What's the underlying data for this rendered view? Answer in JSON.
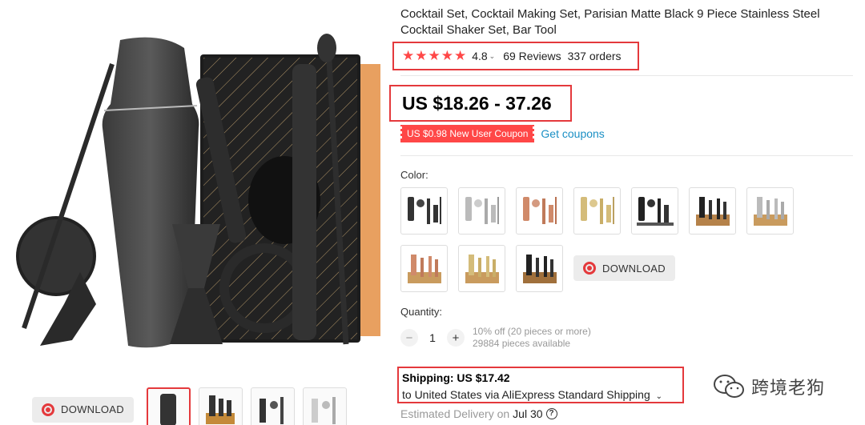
{
  "product": {
    "title": "Cocktail Set, Cocktail Making Set, Parisian Matte Black 9 Piece Stainless Steel Cocktail Shaker Set, Bar Tool",
    "stars": "★★★★★",
    "rating": "4.8",
    "reviews": "69 Reviews",
    "orders": "337 orders",
    "price": "US $18.26 - 37.26",
    "coupon": "US $0.98 New User Coupon",
    "get_coupons": "Get coupons"
  },
  "color": {
    "label": "Color:",
    "swatch_icons": [
      "black-set",
      "silver-set",
      "copper-set",
      "gold-set",
      "black-stand-set",
      "black-wood-set",
      "silver-wood-set",
      "copper-wood-set",
      "gold-wood-set",
      "black-wood-set-2"
    ]
  },
  "download_label": "DOWNLOAD",
  "quantity": {
    "label": "Quantity:",
    "minus": "−",
    "value": "1",
    "plus": "+",
    "discount": "10% off (20 pieces or more)",
    "available": "29884 pieces available"
  },
  "shipping": {
    "cost": "Shipping: US $17.42",
    "destination": "to United States via AliExpress Standard Shipping",
    "caret": "⌄",
    "delivery_label": "Estimated Delivery on",
    "delivery_date": "Jul 30",
    "help": "?"
  },
  "watermark": "跨境老狗",
  "colors": {
    "accent": "#e4393c",
    "star": "#ff4747",
    "link": "#1a8fc4"
  }
}
